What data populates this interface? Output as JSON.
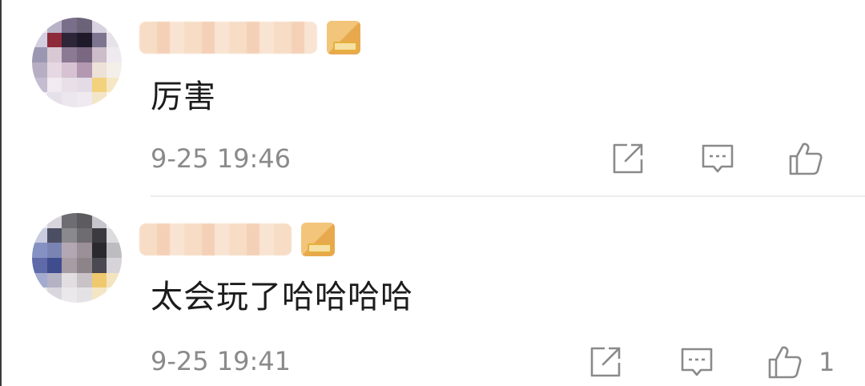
{
  "comments": [
    {
      "text": "厉害",
      "time": "9-25 19:46",
      "actions": {
        "share_icon": "share-external-icon",
        "reply_icon": "comment-bubble-icon",
        "like_icon": "thumbs-up-icon"
      },
      "like_count": ""
    },
    {
      "text": "太会玩了哈哈哈哈",
      "time": "9-25 19:41",
      "actions": {
        "share_icon": "share-external-icon",
        "reply_icon": "comment-bubble-icon",
        "like_icon": "thumbs-up-icon"
      },
      "like_count": "1"
    }
  ],
  "colors": {
    "text": "#1c1c1c",
    "meta": "#8a8a8a",
    "icon": "#8a8a8a",
    "divider": "#ececec"
  }
}
